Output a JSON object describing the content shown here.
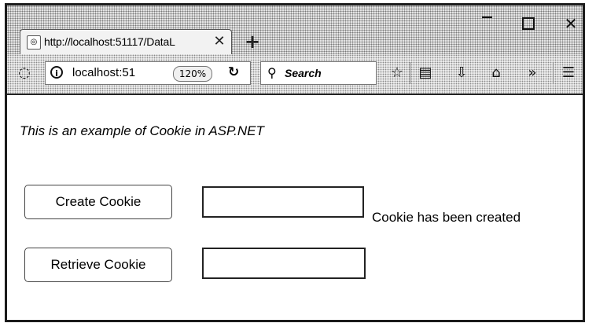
{
  "browser": {
    "tab_title": "http://localhost:51117/DataL",
    "new_tab_symbol": "+",
    "url": "localhost:51",
    "zoom": "120%",
    "search_placeholder": "Search",
    "window_controls": [
      "minimize-icon",
      "maximize-icon",
      "close-icon"
    ],
    "toolbar_icons": [
      "star-icon",
      "reading-list-icon",
      "download-icon",
      "home-icon",
      "overflow-icon",
      "menu-icon"
    ]
  },
  "page": {
    "heading": "This is an example of Cookie in ASP.NET",
    "create_button_label": "Create Cookie",
    "retrieve_button_label": "Retrieve Cookie",
    "create_input_value": "",
    "retrieve_input_value": "",
    "status_text": "Cookie has been created"
  }
}
